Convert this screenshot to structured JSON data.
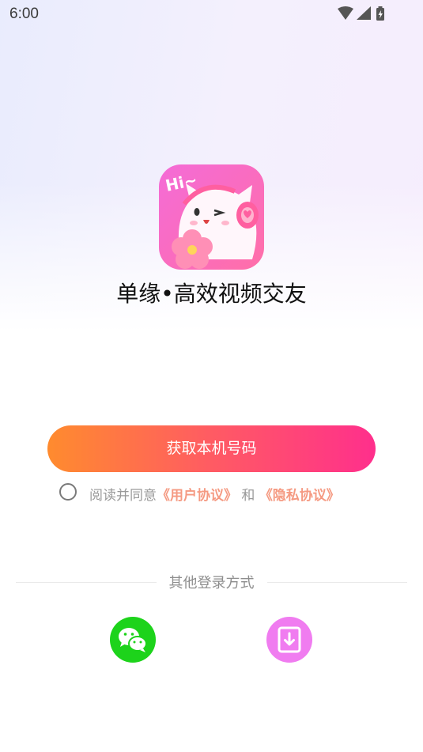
{
  "status_bar": {
    "time": "6:00"
  },
  "app": {
    "name": "单缘•高效视频交友",
    "logo_text": "Hi~"
  },
  "login": {
    "primary_button": "获取本机号码"
  },
  "agreement": {
    "prefix": "阅读并同意",
    "user_agreement": "《用户协议》",
    "conjunction": "和",
    "privacy_policy": "《隐私协议》",
    "checked": false
  },
  "other_login": {
    "label": "其他登录方式",
    "options": [
      {
        "icon": "wechat-icon",
        "color": "#1dd31b"
      },
      {
        "icon": "tablet-download-icon",
        "color": "#f07cf0"
      }
    ]
  },
  "colors": {
    "button_start": "#ff8b2e",
    "button_end": "#ff2f8c",
    "link": "#f59a82"
  }
}
